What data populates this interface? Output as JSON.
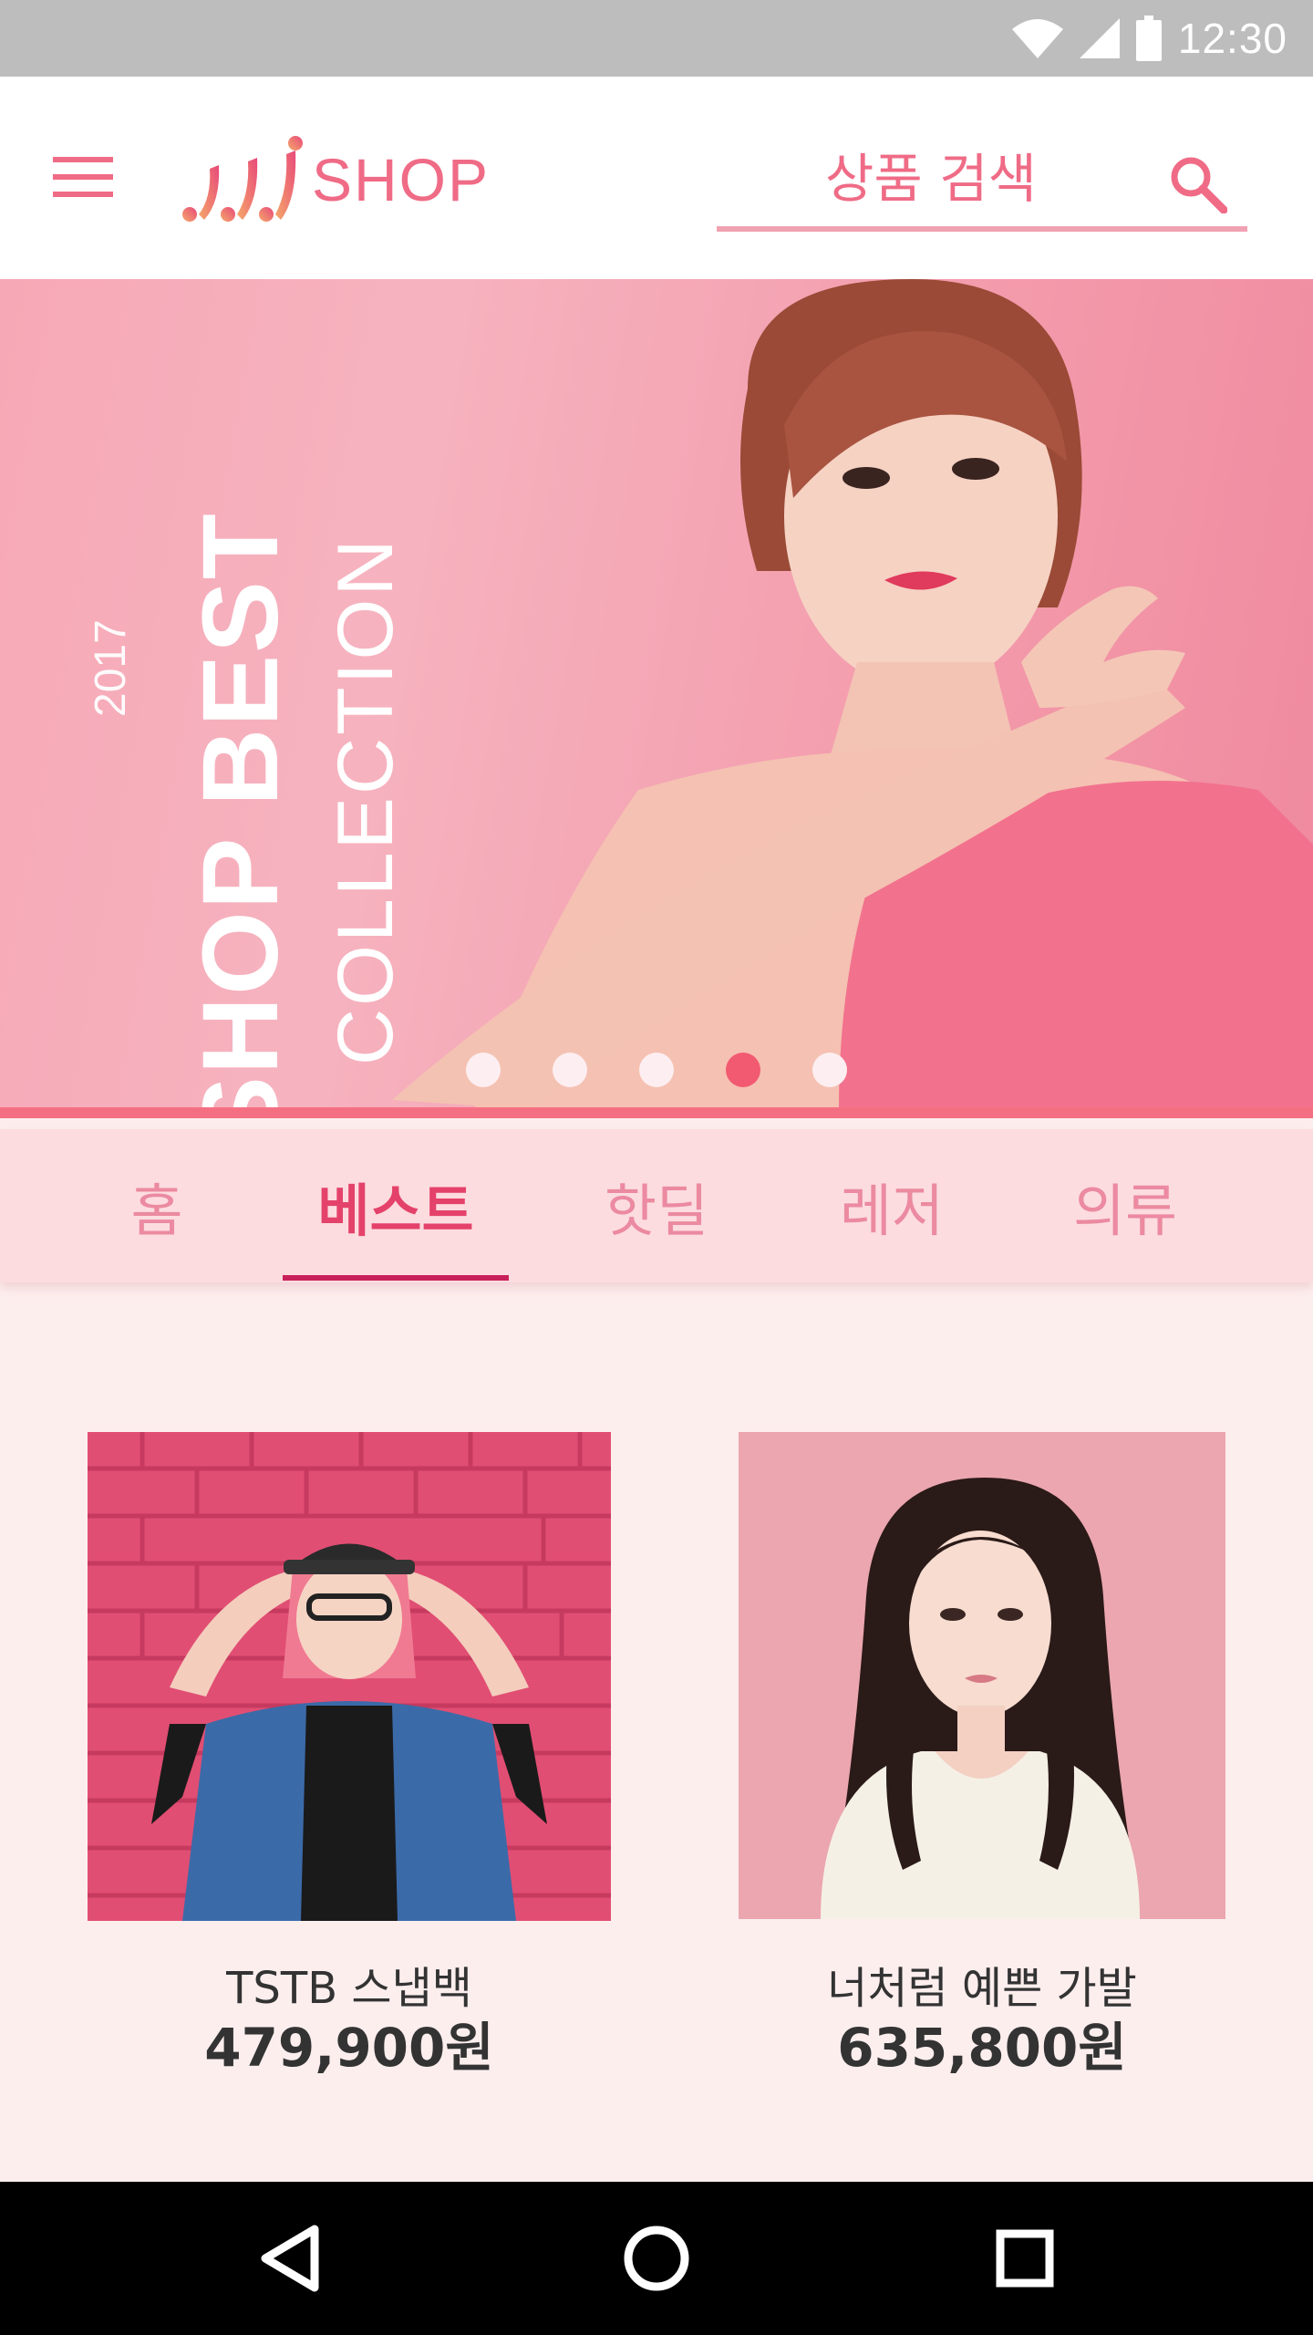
{
  "status_bar": {
    "time": "12:30",
    "icons": [
      "wifi-icon",
      "signal-icon",
      "battery-icon"
    ]
  },
  "header": {
    "logo_text": "SHOP",
    "search_placeholder": "상품 검색",
    "icons": [
      "menu-icon",
      "search-icon"
    ]
  },
  "banner": {
    "year": "2017",
    "title": "JS SHOP BEST",
    "subtitle": "COLLECTION",
    "slide_count": 5,
    "active_slide": 4
  },
  "tabs": [
    {
      "label": "홈",
      "active": false
    },
    {
      "label": "베스트",
      "active": true
    },
    {
      "label": "핫딜",
      "active": false
    },
    {
      "label": "레저",
      "active": false
    },
    {
      "label": "의류",
      "active": false
    }
  ],
  "products": [
    {
      "name": "TSTB 스냅백",
      "price": "479,900원"
    },
    {
      "name": "너처럼 예쁜 가발",
      "price": "635,800원"
    }
  ],
  "nav_bar": {
    "icons": [
      "back-icon",
      "home-icon",
      "recents-icon"
    ]
  },
  "colors": {
    "accent": "#ef6b86",
    "active_tab": "#e4426a",
    "tab_underline": "#c8205a",
    "status_bar": "#bdbdbd",
    "tab_bar_bg": "#fcdcdf",
    "page_bg": "#fdeeee"
  }
}
